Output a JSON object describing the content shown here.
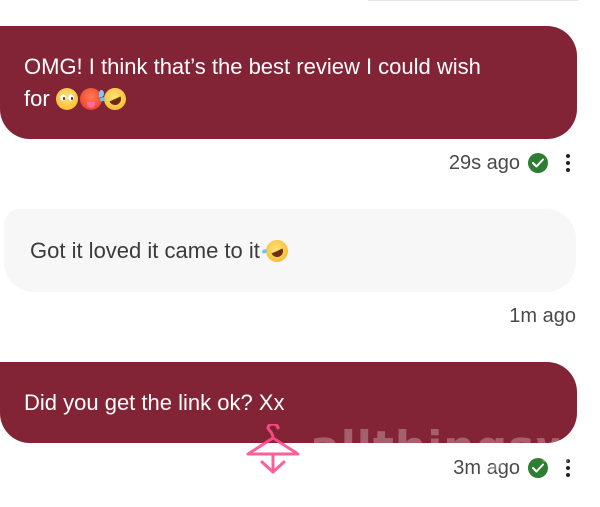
{
  "messages": [
    {
      "type": "sent",
      "text_line1": "OMG! I think that’s the best review I could wish",
      "text_line2": "for",
      "emojis": [
        "pleading-face-icon",
        "hot-face-icon",
        "rofl-face-icon"
      ],
      "time": "29s ago",
      "status": "delivered"
    },
    {
      "type": "received",
      "text": "Got it loved it came to it",
      "emojis": [
        "rofl-face-icon"
      ],
      "time": "1m ago"
    },
    {
      "type": "sent",
      "text": "Did you get the link ok? Xx",
      "time": "3m ago",
      "status": "delivered"
    }
  ],
  "colors": {
    "sent_bubble": "#822435",
    "received_bubble": "#f7f7f8",
    "check": "#2e7d32"
  },
  "watermark": {
    "text": "allthingsworn",
    "icon": "hanger-icon"
  }
}
